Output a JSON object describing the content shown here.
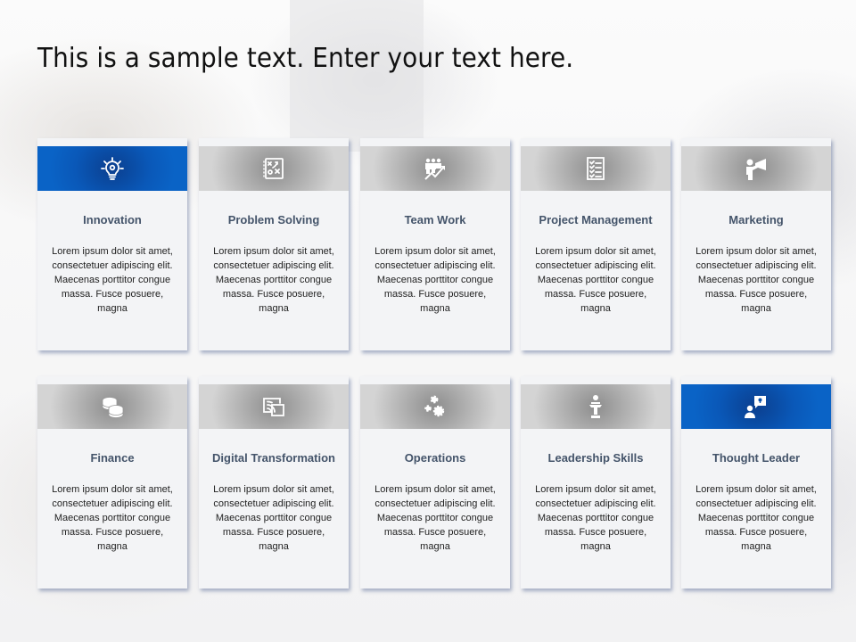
{
  "slide": {
    "title": "This is a sample text. Enter your text here."
  },
  "colors": {
    "accent_blue": "#0a5cbd",
    "band_gray": "#a6a6a6",
    "heading_text": "#44546a",
    "card_bg": "#f3f4f6"
  },
  "cards": [
    {
      "heading": "Innovation",
      "icon": "lightbulb-gear-icon",
      "highlighted": true,
      "body": "Lorem  ipsum dolor sit amet, consectetuer adipiscing elit. Maecenas porttitor congue  massa. Fusce posuere, magna"
    },
    {
      "heading": "Problem Solving",
      "icon": "strategy-board-icon",
      "highlighted": false,
      "body": "Lorem  ipsum dolor sit amet, consectetuer adipiscing elit. Maecenas porttitor congue  massa. Fusce posuere, magna"
    },
    {
      "heading": "Team Work",
      "icon": "team-growth-icon",
      "highlighted": false,
      "body": "Lorem  ipsum dolor sit amet, consectetuer adipiscing elit. Maecenas porttitor congue  massa. Fusce posuere, magna"
    },
    {
      "heading": "Project Management",
      "icon": "checklist-icon",
      "highlighted": false,
      "body": "Lorem  ipsum dolor sit amet, consectetuer adipiscing elit. Maecenas porttitor congue  massa. Fusce posuere, magna"
    },
    {
      "heading": "Marketing",
      "icon": "megaphone-person-icon",
      "highlighted": false,
      "body": "Lorem  ipsum dolor sit amet, consectetuer adipiscing elit. Maecenas porttitor congue  massa. Fusce posuere, magna"
    },
    {
      "heading": "Finance",
      "icon": "coins-icon",
      "highlighted": false,
      "body": "Lorem  ipsum dolor sit amet, consectetuer adipiscing elit. Maecenas porttitor congue  massa. Fusce posuere, magna"
    },
    {
      "heading": "Digital Transformation",
      "icon": "screen-cast-icon",
      "highlighted": false,
      "body": "Lorem  ipsum dolor sit amet, consectetuer adipiscing elit. Maecenas porttitor congue  massa. Fusce posuere, magna"
    },
    {
      "heading": "Operations",
      "icon": "gears-icon",
      "highlighted": false,
      "body": "Lorem  ipsum dolor sit amet, consectetuer adipiscing elit. Maecenas porttitor congue  massa. Fusce posuere, magna"
    },
    {
      "heading": "Leadership Skills",
      "icon": "podium-speaker-icon",
      "highlighted": false,
      "body": "Lorem  ipsum dolor sit amet, consectetuer adipiscing elit. Maecenas porttitor congue  massa. Fusce posuere, magna"
    },
    {
      "heading": "Thought Leader",
      "icon": "person-idea-bubble-icon",
      "highlighted": true,
      "body": "Lorem  ipsum dolor sit amet, consectetuer adipiscing elit. Maecenas porttitor congue  massa. Fusce posuere, magna"
    }
  ]
}
